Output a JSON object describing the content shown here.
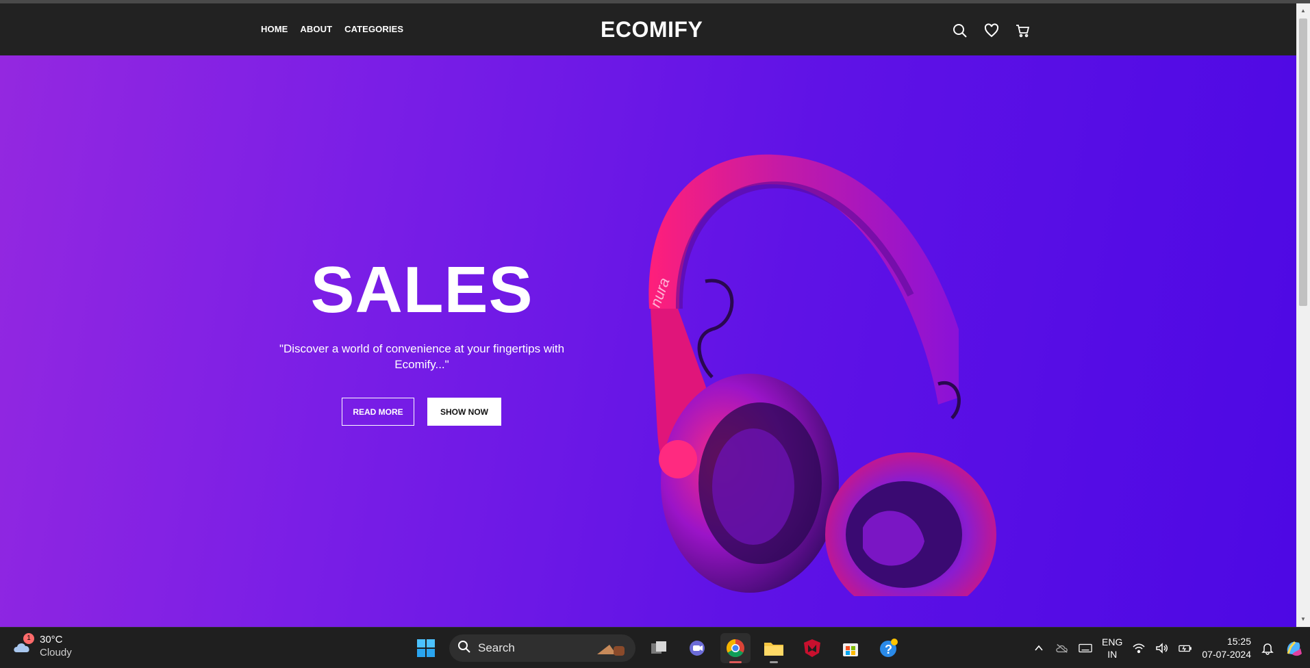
{
  "header": {
    "nav": [
      "HOME",
      "ABOUT",
      "CATEGORIES"
    ],
    "logo": "ECOMIFY",
    "icons": [
      "search-icon",
      "heart-icon",
      "cart-icon"
    ]
  },
  "hero": {
    "title": "SALES",
    "subtitle": "\"Discover a world of convenience at your fingertips with Ecomify...\"",
    "buttons": {
      "read_more": "READ MORE",
      "show_now": "SHOW NOW"
    },
    "product_brand": "nura",
    "colors": {
      "gradient_start": "#9428e0",
      "gradient_end": "#4d08e4",
      "headphone_accent": "#ff1f7a"
    }
  },
  "taskbar": {
    "weather": {
      "temp": "30°C",
      "condition": "Cloudy",
      "badge": "1"
    },
    "search_label": "Search",
    "apps": [
      "start-icon",
      "task-view-icon",
      "teams-icon",
      "chrome-icon",
      "file-explorer-icon",
      "mcafee-icon",
      "store-icon",
      "help-icon"
    ],
    "tray": {
      "lang_top": "ENG",
      "lang_bottom": "IN",
      "time": "15:25",
      "date": "07-07-2024"
    }
  }
}
